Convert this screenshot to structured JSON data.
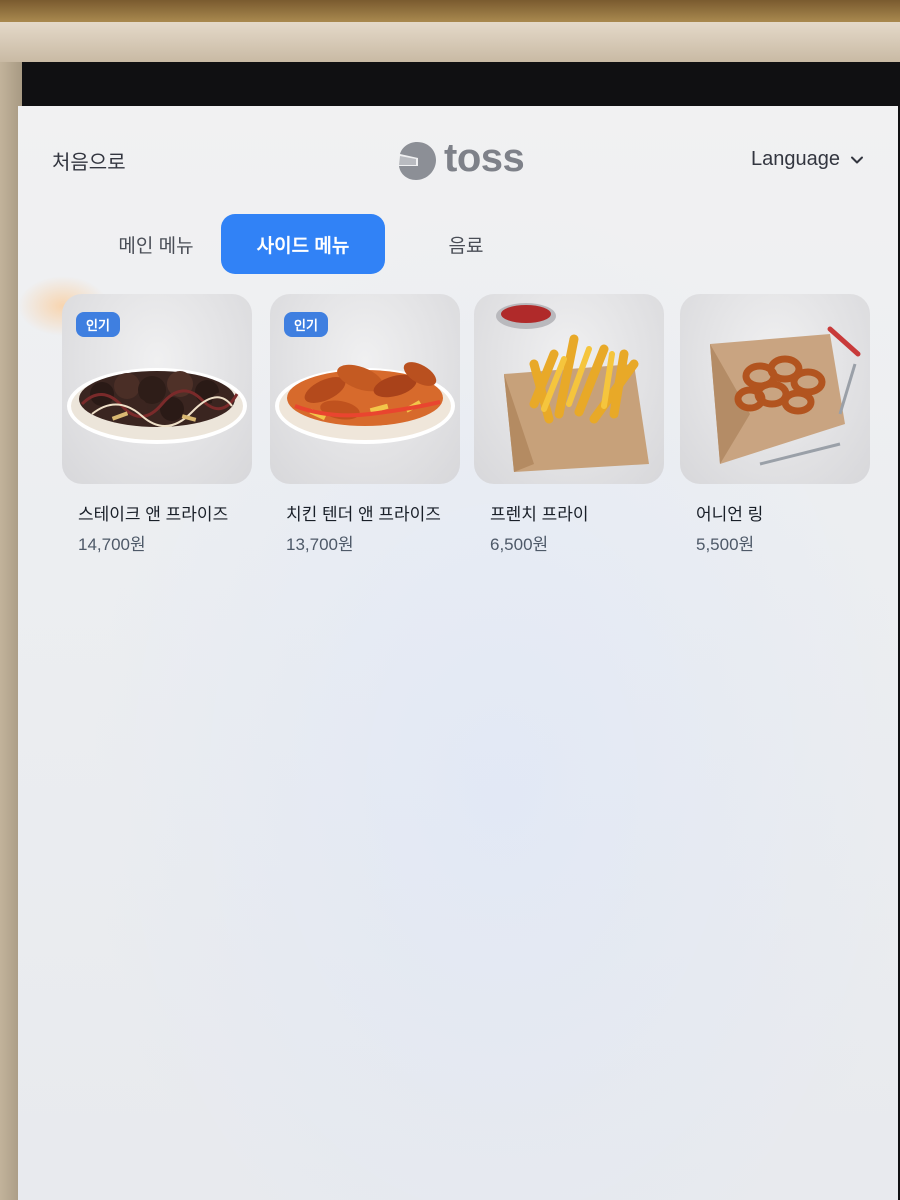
{
  "header": {
    "home_label": "처음으로",
    "logo_text": "toss",
    "language_label": "Language"
  },
  "tabs": [
    {
      "label": "메인 메뉴",
      "active": false
    },
    {
      "label": "사이드 메뉴",
      "active": true
    },
    {
      "label": "음료",
      "active": false
    }
  ],
  "menu_items": [
    {
      "name": "스테이크 앤 프라이즈",
      "price": "14,700원",
      "badge": "인기",
      "image": "steak-fries-plate"
    },
    {
      "name": "치킨 텐더 앤 프라이즈",
      "price": "13,700원",
      "badge": "인기",
      "image": "chicken-tender-plate"
    },
    {
      "name": "프렌치 프라이",
      "price": "6,500원",
      "badge": "",
      "image": "french-fries-bag"
    },
    {
      "name": "어니언 링",
      "price": "5,500원",
      "badge": "",
      "image": "onion-rings-basket"
    }
  ],
  "colors": {
    "accent": "#3182f6",
    "badge": "#3f7fe0",
    "text_primary": "#191f28",
    "text_secondary": "#4e5968"
  }
}
